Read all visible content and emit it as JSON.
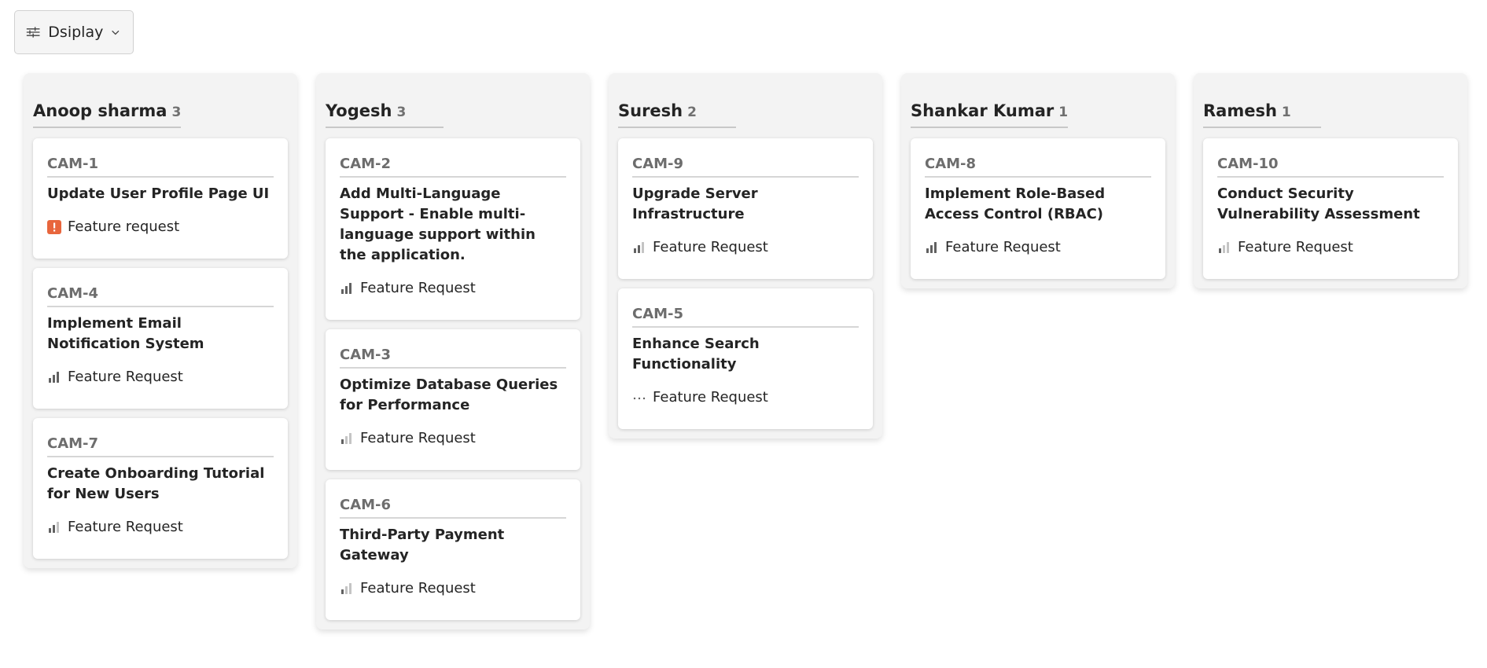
{
  "toolbar": {
    "display_label": "Dsiplay",
    "display_icon": "sliders-icon",
    "dropdown_icon": "chevron-down-icon"
  },
  "colors": {
    "accent_urgent": "#e8663d",
    "bars_dark": "#616161",
    "bars_light": "#c4c4c4",
    "column_bg": "#f3f3f3"
  },
  "columns": [
    {
      "name": "Anoop sharma",
      "count": "3",
      "cards": [
        {
          "id": "CAM-1",
          "title": "Update User Profile Page UI",
          "tag": "Feature request",
          "priority": "urgent"
        },
        {
          "id": "CAM-4",
          "title": "Implement Email Notification System",
          "tag": "Feature Request",
          "priority": "high"
        },
        {
          "id": "CAM-7",
          "title": "Create Onboarding Tutorial for New Users",
          "tag": "Feature Request",
          "priority": "medium"
        }
      ]
    },
    {
      "name": "Yogesh",
      "count": "3",
      "cards": [
        {
          "id": "CAM-2",
          "title": "Add Multi-Language Support - Enable multi-language support within the application.",
          "tag": "Feature Request",
          "priority": "high"
        },
        {
          "id": "CAM-3",
          "title": "Optimize Database Queries for Performance",
          "tag": "Feature Request",
          "priority": "low"
        },
        {
          "id": "CAM-6",
          "title": "Third-Party Payment Gateway",
          "tag": "Feature Request",
          "priority": "low"
        }
      ]
    },
    {
      "name": "Suresh",
      "count": "2",
      "cards": [
        {
          "id": "CAM-9",
          "title": "Upgrade Server Infrastructure",
          "tag": "Feature Request",
          "priority": "medium"
        },
        {
          "id": "CAM-5",
          "title": "Enhance Search Functionality",
          "tag": "Feature Request",
          "priority": "none"
        }
      ]
    },
    {
      "name": "Shankar Kumar",
      "count": "1",
      "cards": [
        {
          "id": "CAM-8",
          "title": "Implement Role-Based Access Control (RBAC)",
          "tag": "Feature Request",
          "priority": "high"
        }
      ]
    },
    {
      "name": "Ramesh",
      "count": "1",
      "cards": [
        {
          "id": "CAM-10",
          "title": "Conduct Security Vulnerability Assessment",
          "tag": "Feature Request",
          "priority": "low"
        }
      ]
    }
  ]
}
